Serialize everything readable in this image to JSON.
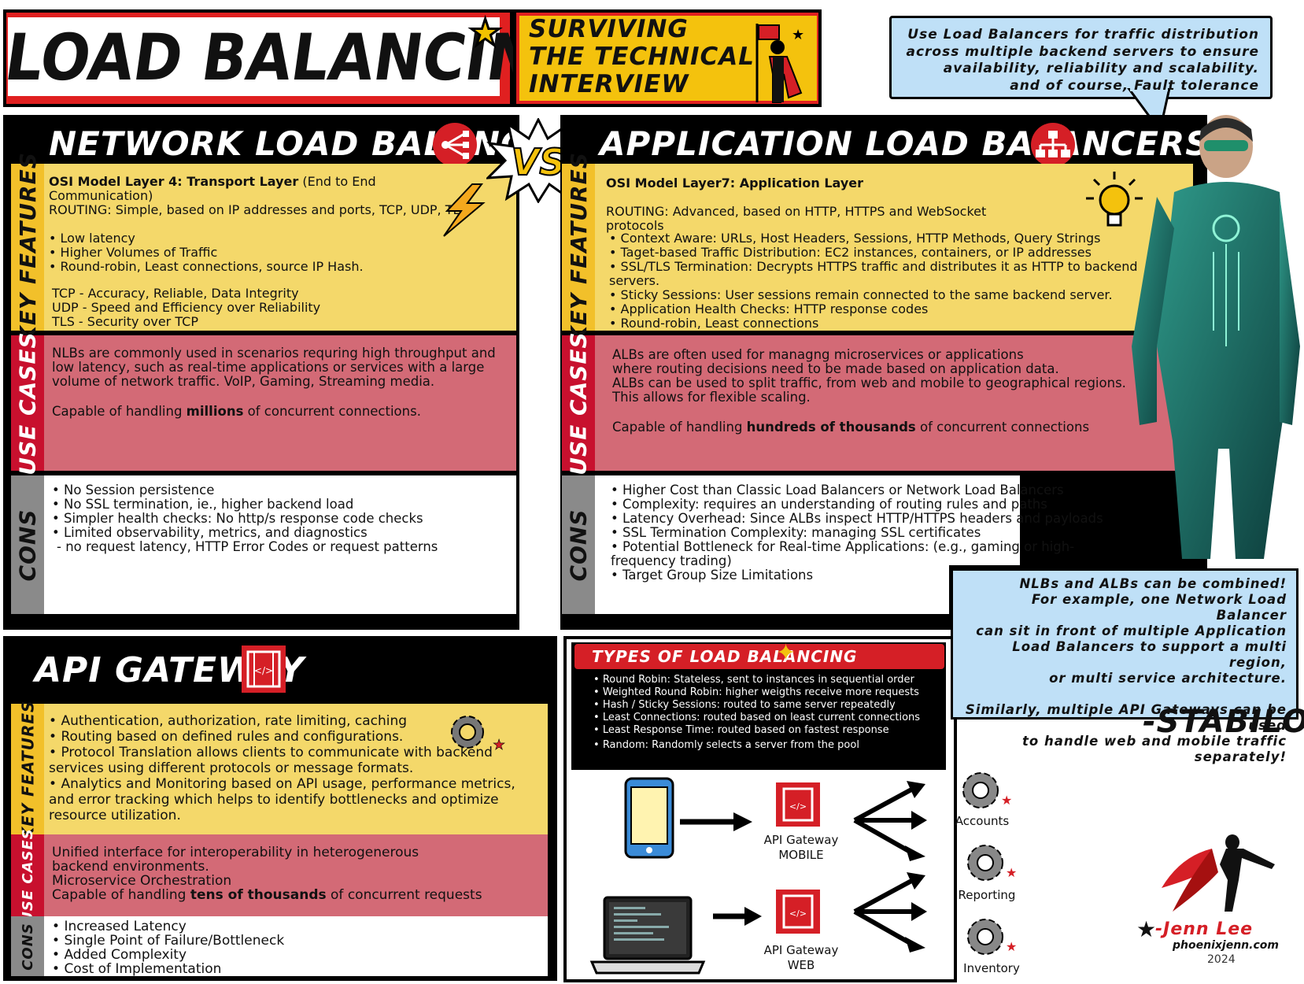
{
  "header": {
    "title": "LOAD BALANCING",
    "subtitle": "SURVIVING\nTHE TECHNICAL\nINTERVIEW"
  },
  "bubble_top": "Use Load Balancers for traffic distribution\nacross multiple backend servers to ensure\navailability, reliability and scalability.\nand of course, Fault tolerance",
  "vs_label": "VS",
  "section_labels": {
    "key_features": "KEY FEATURES",
    "use_cases": "USE CASES",
    "cons": "CONS"
  },
  "nlb": {
    "title": "NETWORK LOAD BALANCERS",
    "osi_bold": "OSI Model Layer 4: Transport Layer",
    "osi_rest": " (End to End Communication)",
    "routing": "ROUTING: Simple, based on IP addresses and ports, TCP, UDP, TLS",
    "features": [
      "Low latency",
      "Higher Volumes of Traffic",
      "Round-robin, Least connections, source IP Hash."
    ],
    "protocols": "TCP - Accuracy, Reliable, Data Integrity\nUDP - Speed and Efficiency over Reliability\nTLS - Security over TCP",
    "use_cases_text": "NLBs are commonly used in scenarios requring high throughput and\nlow latency, such as real-time applications or services with a large\nvolume of network traffic. VoIP, Gaming, Streaming media.",
    "capacity_pre": "Capable of handling ",
    "capacity_bold": "millions",
    "capacity_post": " of concurrent connections.",
    "cons": [
      "No Session persistence",
      "No SSL termination, ie., higher backend load",
      "Simpler health checks: No http/s response code checks",
      "Limited observability, metrics, and diagnostics"
    ],
    "cons_sub": "- no request latency, HTTP Error Codes or request patterns"
  },
  "alb": {
    "title": "APPLICATION LOAD BALANCERS",
    "osi": "OSI Model Layer7: Application Layer",
    "routing": "ROUTING: Advanced, based on HTTP, HTTPS and WebSocket protocols",
    "features": [
      "Context Aware: URLs, Host Headers, Sessions, HTTP Methods, Query Strings",
      "Taget-based Traffic Distribution: EC2 instances, containers, or IP addresses",
      "SSL/TLS Termination: Decrypts HTTPS traffic and distributes it as HTTP to backend servers.",
      "Sticky Sessions: User sessions remain connected to the same backend server.",
      "Application Health Checks:  HTTP response codes",
      "Round-robin, Least connections"
    ],
    "use_cases_text": "ALBs are often used for managng microservices or applications\nwhere routing decisions need to be made based on application data.\nALBs can be used to split traffic, from web and mobile to geographical regions.\nThis allows for flexible scaling.",
    "capacity_pre": "Capable of handling ",
    "capacity_bold": "hundreds of thousands",
    "capacity_post": " of concurrent connections",
    "cons": [
      "Higher Cost than Classic Load Balancers or Network Load Balancers",
      "Complexity:  requires an understanding of routing rules and paths",
      "Latency Overhead: Since ALBs inspect HTTP/HTTPS headers and payloads",
      "SSL Termination Complexity: managing SSL certificates",
      "Potential Bottleneck for Real-time Applications: (e.g., gaming or high-frequency trading)",
      "Target Group Size Limitations"
    ]
  },
  "api": {
    "title": "API GATEWAY",
    "features": [
      "Authentication, authorization, rate limiting, caching",
      "Routing based on defined rules and configurations.",
      "Protocol Translation allows clients to communicate with backend services using different protocols or message formats.",
      "Analytics and Monitoring based on API usage, performance metrics, and error tracking which helps to identify bottlenecks and optimize resource utilization."
    ],
    "use_cases_text": "Unified interface for interoperability in heterogenerous\nbackend environments.\nMicroservice Orchestration",
    "capacity_pre": "Capable of handling ",
    "capacity_bold": "tens of thousands",
    "capacity_post": " of concurrent requests",
    "cons": [
      "Increased Latency",
      "Single Point of Failure/Bottleneck",
      "Added Complexity",
      "Cost of Implementation"
    ]
  },
  "types": {
    "title": "TYPES OF LOAD BALANCING",
    "items": [
      "Round Robin: Stateless, sent to instances in sequential order",
      "Weighted Round Robin: higher weigths receive more requests",
      "Hash / Sticky Sessions: routed to same server repeatedly",
      "Least Connections: routed based on least current connections",
      "Least Response Time: routed based on fastest response",
      "Random: Randomly selects a server from the pool"
    ]
  },
  "diagram": {
    "gateway_mobile": "API Gateway\nMOBILE",
    "gateway_web": "API Gateway\nWEB",
    "services": [
      "Accounts",
      "Reporting",
      "Inventory"
    ]
  },
  "combo_bubble": "NLBs and ALBs can be combined!\nFor example, one Network Load Balancer\ncan sit in front of multiple Application\nLoad Balancers to  support a multi region,\nor multi service architecture.\n\nSimilarly, multiple API Gateways can be used\nto handle web and mobile traffic separately!",
  "signature": "-STABILON",
  "author": {
    "name": "-Jenn Lee",
    "site": "phoenixjenn.com",
    "year": "2024"
  },
  "colors": {
    "red": "#d51f26",
    "yellow": "#f4d86a",
    "rose": "#d36a76",
    "bubble_blue": "#bfe0f7",
    "tab_gold": "#f2c02a"
  }
}
